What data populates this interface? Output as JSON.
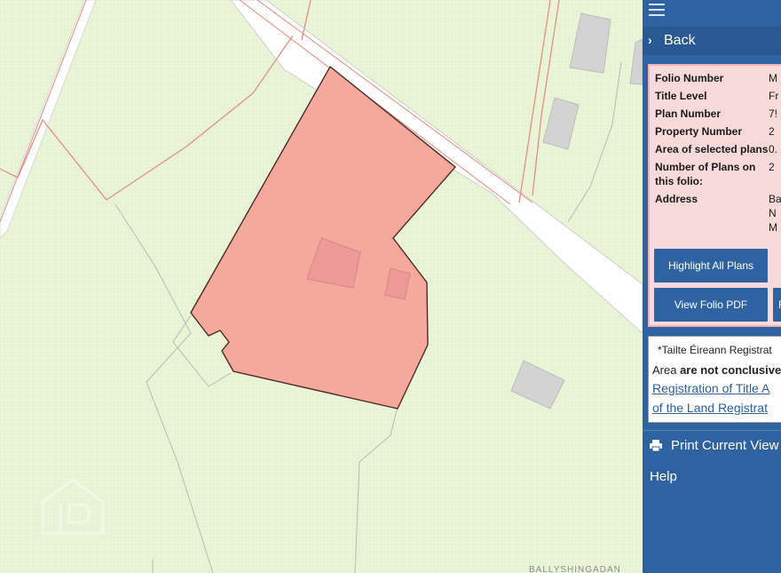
{
  "panel": {
    "back_label": "Back",
    "info_rows": [
      {
        "key": "Folio Number",
        "value": "M"
      },
      {
        "key": "Title Level",
        "value": "Fr"
      },
      {
        "key": "Plan Number",
        "value": "7!"
      },
      {
        "key": "Property Number",
        "value": "2"
      },
      {
        "key": "Area of selected plans",
        "value": "0."
      },
      {
        "key": "Number of Plans on this folio:",
        "value": "2"
      },
      {
        "key": "Address",
        "value": "Ba\nN\nM"
      }
    ],
    "highlight_button": "Highlight All Plans",
    "pdf_button": "View Folio PDF",
    "extra_button": "F",
    "disclaimer": {
      "line1": "*Tailte Éireann Registrat",
      "line2_prefix": "Area ",
      "line2_bold": "are not conclusive",
      "link1": "Registration of Title A",
      "link2": "of the Land Registrat"
    },
    "print_label": "Print Current View",
    "help_label": "Help"
  },
  "map": {
    "road_label": "BALLYSHINGADAN",
    "parcel_color": "#f5a99a",
    "background_color": "#eaf4d6"
  },
  "icons": [
    "menu-icon",
    "chevron-right-icon",
    "print-icon",
    "watermark-logo"
  ]
}
